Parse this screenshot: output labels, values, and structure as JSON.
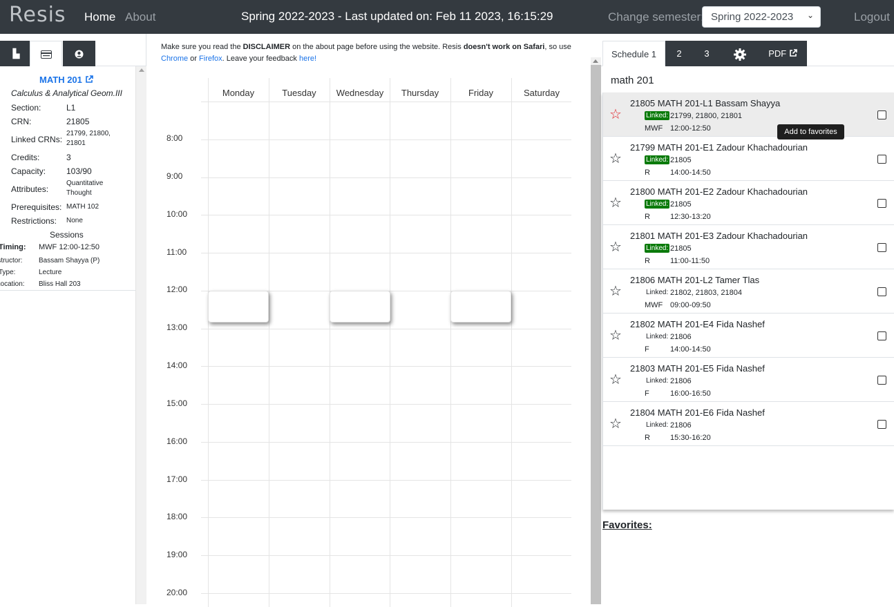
{
  "navbar": {
    "logo": "Resis",
    "home": "Home",
    "about": "About",
    "title": "Spring 2022-2023 - Last updated on: Feb 11 2023, 16:15:29",
    "change_semester": "Change semester:",
    "semester_selected": "Spring 2022-2023",
    "logout": "Logout"
  },
  "left": {
    "tabs": [
      {
        "icon": "building-icon",
        "glyph": "▙"
      },
      {
        "icon": "card-icon",
        "glyph": "▬"
      },
      {
        "icon": "user-circle-icon",
        "glyph": "●"
      }
    ],
    "course_code": "MATH 201",
    "course_name": "Calculus & Analytical Geom.III",
    "fields": [
      {
        "label": "Section:",
        "value": "L1"
      },
      {
        "label": "CRN:",
        "value": "21805"
      },
      {
        "label": "Linked CRNs:",
        "value": "21799, 21800, 21801"
      },
      {
        "label": "Credits:",
        "value": "3"
      },
      {
        "label": "Capacity:",
        "value": "103/90"
      },
      {
        "label": "Attributes:",
        "value": "Quantitative Thought"
      },
      {
        "label": "Prerequisites:",
        "value": "MATH 102"
      },
      {
        "label": "Restrictions:",
        "value": "None"
      }
    ],
    "sessions_title": "Sessions",
    "sessions": [
      {
        "label": "Timing:",
        "value": "MWF 12:00-12:50"
      },
      {
        "label": "Instructor:",
        "value": "Bassam Shayya (P)"
      },
      {
        "label": "Type:",
        "value": "Lecture"
      },
      {
        "label": "Location:",
        "value": "Bliss Hall 203"
      }
    ]
  },
  "center": {
    "notice_1": "Make sure you read the ",
    "notice_disclaimer": "DISCLAIMER",
    "notice_2": " on the about page before using the website. Resis ",
    "notice_safari": "doesn't work on Safari",
    "notice_3": ", so use ",
    "notice_chrome": "Chrome",
    "notice_4": " or ",
    "notice_firefox": "Firefox",
    "notice_5": ". Leave your feedback ",
    "notice_here": "here!",
    "days": [
      "Monday",
      "Tuesday",
      "Wednesday",
      "Thursday",
      "Friday",
      "Saturday"
    ],
    "hours": [
      "8:00",
      "9:00",
      "10:00",
      "11:00",
      "12:00",
      "13:00",
      "14:00",
      "15:00",
      "16:00",
      "17:00",
      "18:00",
      "19:00",
      "20:00"
    ]
  },
  "right": {
    "tabs": [
      "Schedule 1",
      "2",
      "3",
      "",
      "PDF"
    ],
    "search_value": "math 201",
    "tooltip": "Add to favorites",
    "results": [
      {
        "title": "21805 MATH 201-L1 Bassam Shayya",
        "linked_label": "Linked:",
        "linked_badge": true,
        "crns": "21799, 21800, 21801",
        "days": "MWF",
        "time": "12:00-12:50",
        "star_red": true
      },
      {
        "title": "21799 MATH 201-E1 Zadour Khachadourian",
        "linked_label": "Linked:",
        "linked_badge": true,
        "crns": "21805",
        "days": "R",
        "time": "14:00-14:50",
        "star_red": false
      },
      {
        "title": "21800 MATH 201-E2 Zadour Khachadourian",
        "linked_label": "Linked:",
        "linked_badge": true,
        "crns": "21805",
        "days": "R",
        "time": "12:30-13:20",
        "star_red": false
      },
      {
        "title": "21801 MATH 201-E3 Zadour Khachadourian",
        "linked_label": "Linked:",
        "linked_badge": true,
        "crns": "21805",
        "days": "R",
        "time": "11:00-11:50",
        "star_red": false
      },
      {
        "title": "21806 MATH 201-L2 Tamer Tlas",
        "linked_label": "Linked:",
        "linked_badge": false,
        "crns": "21802, 21803, 21804",
        "days": "MWF",
        "time": "09:00-09:50",
        "star_red": false
      },
      {
        "title": "21802 MATH 201-E4 Fida Nashef",
        "linked_label": "Linked:",
        "linked_badge": false,
        "crns": "21806",
        "days": "F",
        "time": "14:00-14:50",
        "star_red": false
      },
      {
        "title": "21803 MATH 201-E5 Fida Nashef",
        "linked_label": "Linked:",
        "linked_badge": false,
        "crns": "21806",
        "days": "F",
        "time": "16:00-16:50",
        "star_red": false
      },
      {
        "title": "21804 MATH 201-E6 Fida Nashef",
        "linked_label": "Linked:",
        "linked_badge": false,
        "crns": "21806",
        "days": "R",
        "time": "15:30-16:20",
        "star_red": false
      }
    ],
    "favorites_title": "Favorites:"
  }
}
